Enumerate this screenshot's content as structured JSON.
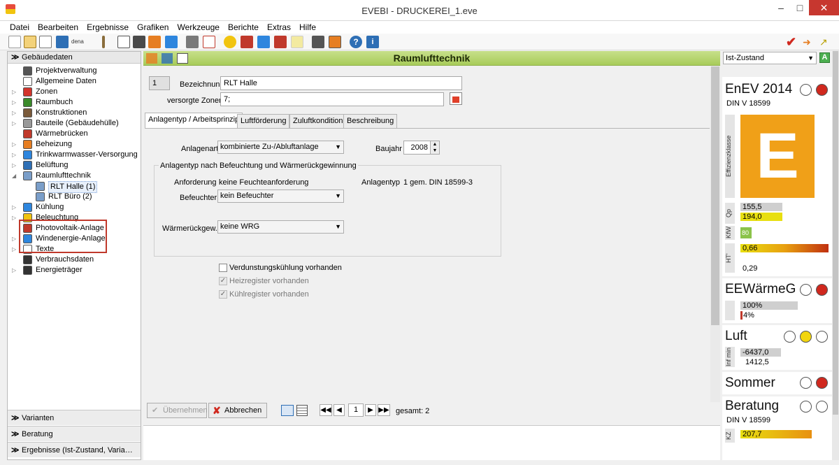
{
  "window": {
    "title": "EVEBI - DRUCKEREI_1.eve"
  },
  "menu": [
    "Datei",
    "Bearbeiten",
    "Ergebnisse",
    "Grafiken",
    "Werkzeuge",
    "Berichte",
    "Extras",
    "Hilfe"
  ],
  "left": {
    "header": "Gebäudedaten",
    "tree": [
      {
        "label": "Projektverwaltung",
        "icon": "gear-icon",
        "color": "#555555"
      },
      {
        "label": "Allgemeine Daten",
        "icon": "document-icon",
        "color": "#ffffff"
      },
      {
        "label": "Zonen",
        "icon": "zone-house-icon",
        "color": "#d2342c"
      },
      {
        "label": "Raumbuch",
        "icon": "book-icon",
        "color": "#3a8a2a"
      },
      {
        "label": "Konstruktionen",
        "icon": "construction-icon",
        "color": "#7a5a3a"
      },
      {
        "label": "Bauteile (Gebäudehülle)",
        "icon": "house-icon",
        "color": "#999999"
      },
      {
        "label": "Wärmebrücken",
        "icon": "thermal-bridge-icon",
        "color": "#c0392b"
      },
      {
        "label": "Beheizung",
        "icon": "flame-icon",
        "color": "#e67e22"
      },
      {
        "label": "Trinkwarmwasser-Versorgung",
        "icon": "water-drop-icon",
        "color": "#2e86de"
      },
      {
        "label": "Belüftung",
        "icon": "fan-icon",
        "color": "#2e6fb5"
      },
      {
        "label": "Raumlufttechnik",
        "icon": "air-duct-icon",
        "color": "#7a9ec9"
      },
      {
        "label": "RLT Halle (1)",
        "icon": "air-duct-icon",
        "color": "#7a9ec9"
      },
      {
        "label": "RLT Büro (2)",
        "icon": "air-duct-icon",
        "color": "#7a9ec9"
      },
      {
        "label": "Kühlung",
        "icon": "snowflake-icon",
        "color": "#2e86de"
      },
      {
        "label": "Beleuchtung",
        "icon": "bulb-icon",
        "color": "#f1c40f"
      },
      {
        "label": "Photovoltaik-Anlage",
        "icon": "pv-icon",
        "color": "#c0392b"
      },
      {
        "label": "Windenergie-Anlage",
        "icon": "wind-icon",
        "color": "#2e86de"
      },
      {
        "label": "Texte",
        "icon": "text-icon",
        "color": "#ffffff"
      },
      {
        "label": "Verbrauchsdaten",
        "icon": "consumption-icon",
        "color": "#333333"
      },
      {
        "label": "Energieträger",
        "icon": "energy-carrier-icon",
        "color": "#333333"
      }
    ],
    "bottom": [
      "Varianten",
      "Beratung",
      "Ergebnisse (Ist-Zustand, Varia…"
    ]
  },
  "center": {
    "title": "Raumlufttechnik",
    "number": "1",
    "bezeichnung_label": "Bezeichnung",
    "bezeichnung_value": "RLT Halle",
    "zonen_label": "versorgte Zonen",
    "zonen_value": "7;",
    "tabs": [
      "Anlagentyp / Arbeitsprinzip",
      "Luftförderung",
      "Zuluftkondition",
      "Beschreibung"
    ],
    "anlagenart_label": "Anlagenart",
    "anlagenart_value": "kombinierte Zu-/Abluftanlage",
    "baujahr_label": "Baujahr",
    "baujahr_value": "2008",
    "group_title": "Anlagentyp nach Befeuchtung und Wärmerückgewinnung",
    "anforderung_label": "Anforderung",
    "anforderung_value": "keine Feuchteanforderung",
    "anlagentyp_label": "Anlagentyp",
    "anlagentyp_value": "1 gem. DIN 18599-3",
    "befeuchter_label": "Befeuchter",
    "befeuchter_value": "kein Befeuchter",
    "wrg_label": "Wärmerückgew.",
    "wrg_value": "keine WRG",
    "check1": "Verdunstungskühlung vorhanden",
    "check2": "Heizregister vorhanden",
    "check3": "Kühlregister vorhanden",
    "btn_apply": "Übernehmen",
    "btn_cancel": "Abbrechen",
    "page": "1",
    "total": "gesamt: 2"
  },
  "right": {
    "state": "Ist-Zustand",
    "enev_title": "EnEV 2014",
    "din": "DIN V 18599",
    "effizienz_label": "Effizienzklasse",
    "effizienz_class": "E",
    "effizienz_color": "#f0a018",
    "qp_label": "Qp",
    "qp1": "155,5",
    "qp2": "194,0",
    "kfw_label": "KfW",
    "kfw": "80",
    "ht_label": "HT'",
    "ht1": "0,66",
    "ht2": "0,29",
    "ee_title": "EEWärmeG",
    "ee1": "100%",
    "ee2": "4%",
    "luft_title": "Luft",
    "inf_label": "Inf min",
    "luft1": "-6437,0",
    "luft2": "1412,5",
    "sommer_title": "Sommer",
    "beratung_title": "Beratung",
    "beratung_din": "DIN V 18599",
    "kz_label": "KZ",
    "kz": "207,7"
  }
}
